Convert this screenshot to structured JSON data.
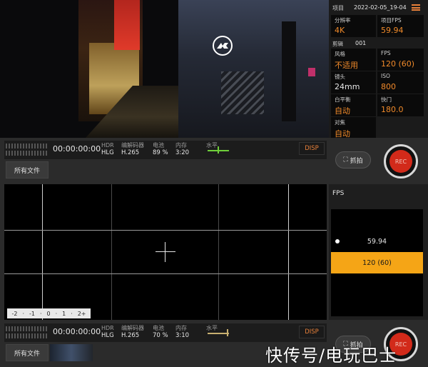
{
  "top_status": {
    "timecode": "00:00:00:00",
    "hdr_label": "HDR",
    "hdr_value": "HLG",
    "codec_label": "编解码器",
    "codec_value": "H.265",
    "battery_label": "电池",
    "battery_value": "89 %",
    "storage_label": "内存",
    "storage_value": "3:20",
    "level_label": "水平",
    "disp_label": "DISP",
    "meter_rows": [
      "1",
      "2"
    ]
  },
  "bottom_status": {
    "timecode": "00:00:00:00",
    "hdr_label": "HDR",
    "hdr_value": "HLG",
    "codec_label": "编解码器",
    "codec_value": "H.265",
    "battery_label": "电池",
    "battery_value": "70 %",
    "storage_label": "内存",
    "storage_value": "3:10",
    "level_label": "水平",
    "disp_label": "DISP",
    "meter_rows": [
      "1",
      "2"
    ]
  },
  "files_button": "所有文件",
  "snapshot_button": "抓拍",
  "rec_button": "REC",
  "settings": {
    "project_label": "项目",
    "project_value": "2022-02-05_19-04",
    "clip_label": "剪辑",
    "clip_value": "001",
    "cells": [
      {
        "label": "分辨率",
        "value": "4K"
      },
      {
        "label": "项目FPS",
        "value": "59.94"
      },
      {
        "label": "风格",
        "value": "不适用"
      },
      {
        "label": "FPS",
        "value": "120 (60)"
      },
      {
        "label": "镜头",
        "value": "24mm"
      },
      {
        "label": "ISO",
        "value": "800"
      },
      {
        "label": "白平衡",
        "value": "自动"
      },
      {
        "label": "快门",
        "value": "180.0"
      },
      {
        "label": "对焦",
        "value": "自动"
      }
    ]
  },
  "exposure_scale": {
    "ticks": [
      "-2",
      "·",
      "-1",
      "·",
      "0",
      "·",
      "1",
      "·",
      "2+"
    ]
  },
  "fps_panel": {
    "title": "FPS",
    "options": [
      {
        "label": "59.94",
        "selected": false,
        "dot": true
      },
      {
        "label": "120 (60)",
        "selected": true,
        "dot": false
      }
    ]
  },
  "watermark": "快传号/电玩巴士",
  "colors": {
    "accent": "#f08a2a",
    "selected": "#f5a516",
    "rec": "#d22a1a",
    "level": "#6fcf3a"
  }
}
